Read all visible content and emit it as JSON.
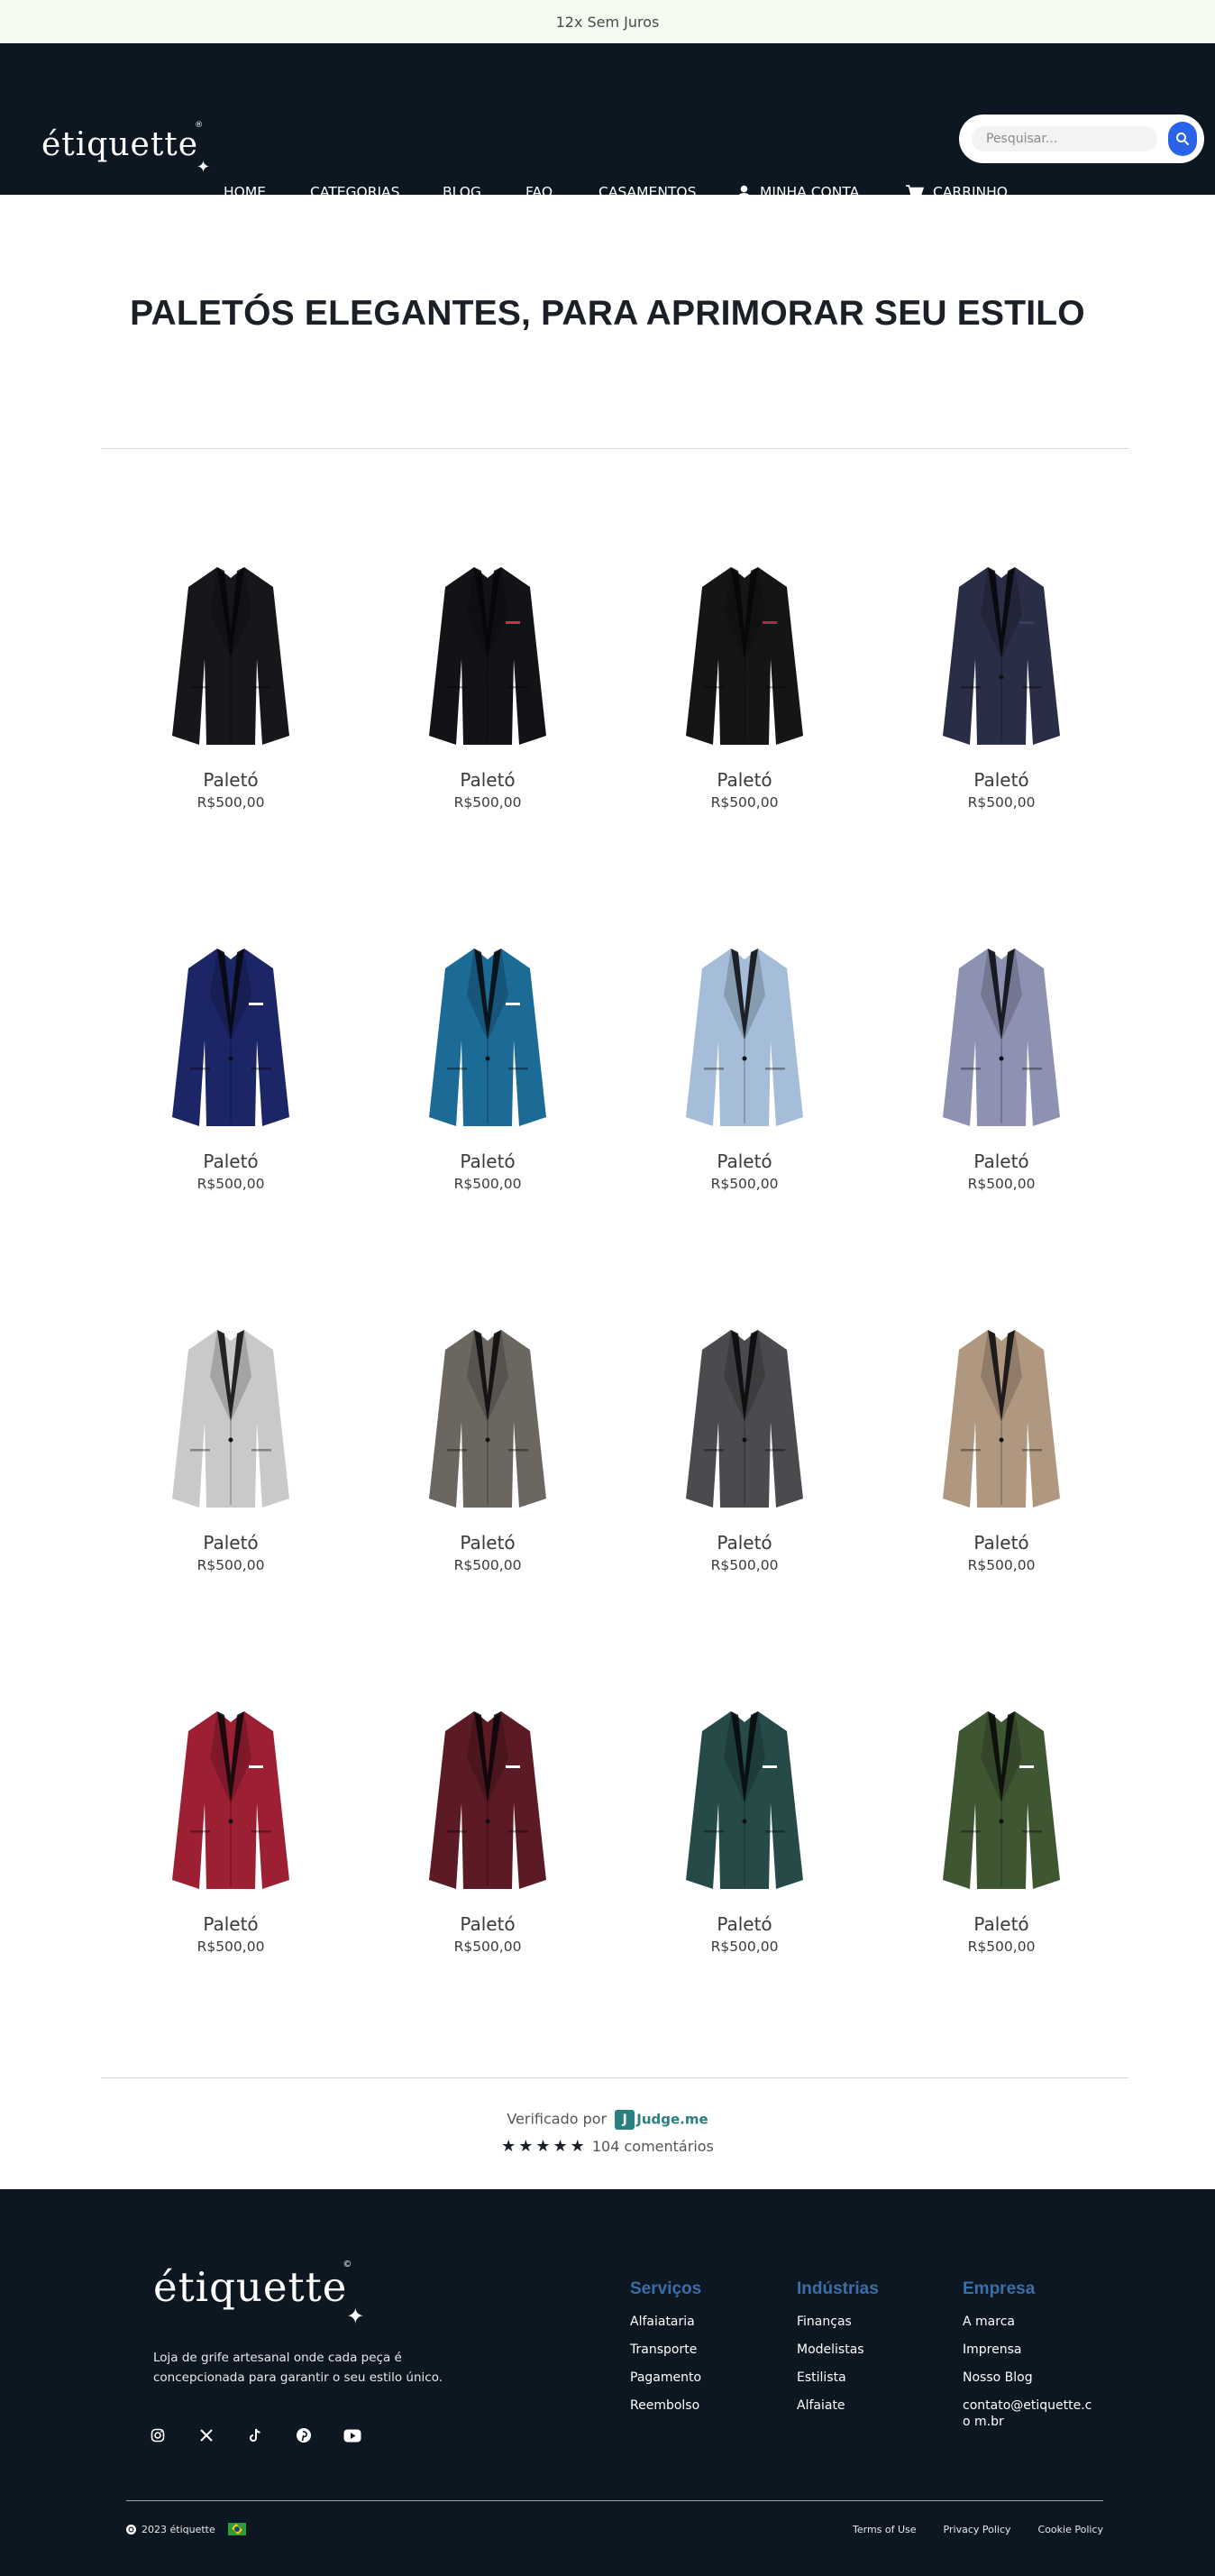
{
  "announcement": "12x Sem Juros",
  "header": {
    "logo": "étiquette",
    "logo_sparkle": "✦",
    "logo_reg": "®",
    "search_placeholder": "Pesquisar..."
  },
  "nav": [
    {
      "label": "HOME"
    },
    {
      "label": "CATEGORIAS"
    },
    {
      "label": "BLOG"
    },
    {
      "label": "FAQ"
    },
    {
      "label": "CASAMENTOS"
    },
    {
      "label": "MINHA CONTA",
      "icon": "user-icon"
    },
    {
      "label": "CARRINHO",
      "icon": "cart-icon"
    }
  ],
  "page_title": "PALETÓS ELEGANTES, PARA APRIMORAR SEU ESTILO",
  "products": [
    {
      "name": "Paletó",
      "price": "R$500,00",
      "color": "#15171b",
      "trim": "#15171b"
    },
    {
      "name": "Paletó",
      "price": "R$500,00",
      "color": "#121316",
      "trim": "#c7324a"
    },
    {
      "name": "Paletó",
      "price": "R$500,00",
      "color": "#141517",
      "trim": "#b8254a"
    },
    {
      "name": "Paletó",
      "price": "R$500,00",
      "color": "#2a2d46",
      "trim": "#3a3f5c"
    },
    {
      "name": "Paletó",
      "price": "R$500,00",
      "color": "#1c2566",
      "trim": "#ffffff"
    },
    {
      "name": "Paletó",
      "price": "R$500,00",
      "color": "#1c6a96",
      "trim": "#ffffff"
    },
    {
      "name": "Paletó",
      "price": "R$500,00",
      "color": "#a5bdd8",
      "trim": "#a5bdd8"
    },
    {
      "name": "Paletó",
      "price": "R$500,00",
      "color": "#8d92b3",
      "trim": "#8d92b3"
    },
    {
      "name": "Paletó",
      "price": "R$500,00",
      "color": "#c9c9c9",
      "trim": "#c9c9c9"
    },
    {
      "name": "Paletó",
      "price": "R$500,00",
      "color": "#6b6660",
      "trim": "#6b6660"
    },
    {
      "name": "Paletó",
      "price": "R$500,00",
      "color": "#4a4b4e",
      "trim": "#4a4b4e"
    },
    {
      "name": "Paletó",
      "price": "R$500,00",
      "color": "#b09880",
      "trim": "#b09880"
    },
    {
      "name": "Paletó",
      "price": "R$500,00",
      "color": "#9c1f33",
      "trim": "#ffffff"
    },
    {
      "name": "Paletó",
      "price": "R$500,00",
      "color": "#5c1a25",
      "trim": "#ffffff"
    },
    {
      "name": "Paletó",
      "price": "R$500,00",
      "color": "#254a48",
      "trim": "#ffffff"
    },
    {
      "name": "Paletó",
      "price": "R$500,00",
      "color": "#3f5633",
      "trim": "#ffffff"
    }
  ],
  "reviews": {
    "verified_prefix": "Verificado por",
    "badge_letter": "J",
    "provider": "Judge.me",
    "stars": "★★★★★",
    "count_text": "104 comentários"
  },
  "footer": {
    "logo": "étiquette",
    "logo_sparkle": "✦",
    "logo_reg": "©",
    "description": "Loja de grife artesanal onde cada peça é concepcionada para garantir o seu estilo único.",
    "socials": [
      "instagram-icon",
      "x-icon",
      "tiktok-icon",
      "pinterest-icon",
      "youtube-icon"
    ],
    "columns": [
      {
        "title": "Serviços",
        "links": [
          "Alfaiataria",
          "Transporte",
          "Pagamento",
          "Reembolso"
        ]
      },
      {
        "title": "Indústrias",
        "links": [
          "Finanças",
          "Modelistas",
          "Estilista",
          "Alfaiate"
        ]
      },
      {
        "title": "Empresa",
        "links": [
          "A marca",
          "Imprensa",
          "Nosso Blog",
          "contato@etiquette.co m.br"
        ]
      }
    ],
    "copyright": "2023 étiquette",
    "bottom_links": [
      "Terms of Use",
      "Privacy Policy",
      "Cookie Policy"
    ]
  },
  "colors": {
    "header_bg": "#0d1722",
    "announcement_bg": "#f4fbf0",
    "accent_blue": "#2a62e8",
    "footer_heading": "#3a6ea8"
  }
}
